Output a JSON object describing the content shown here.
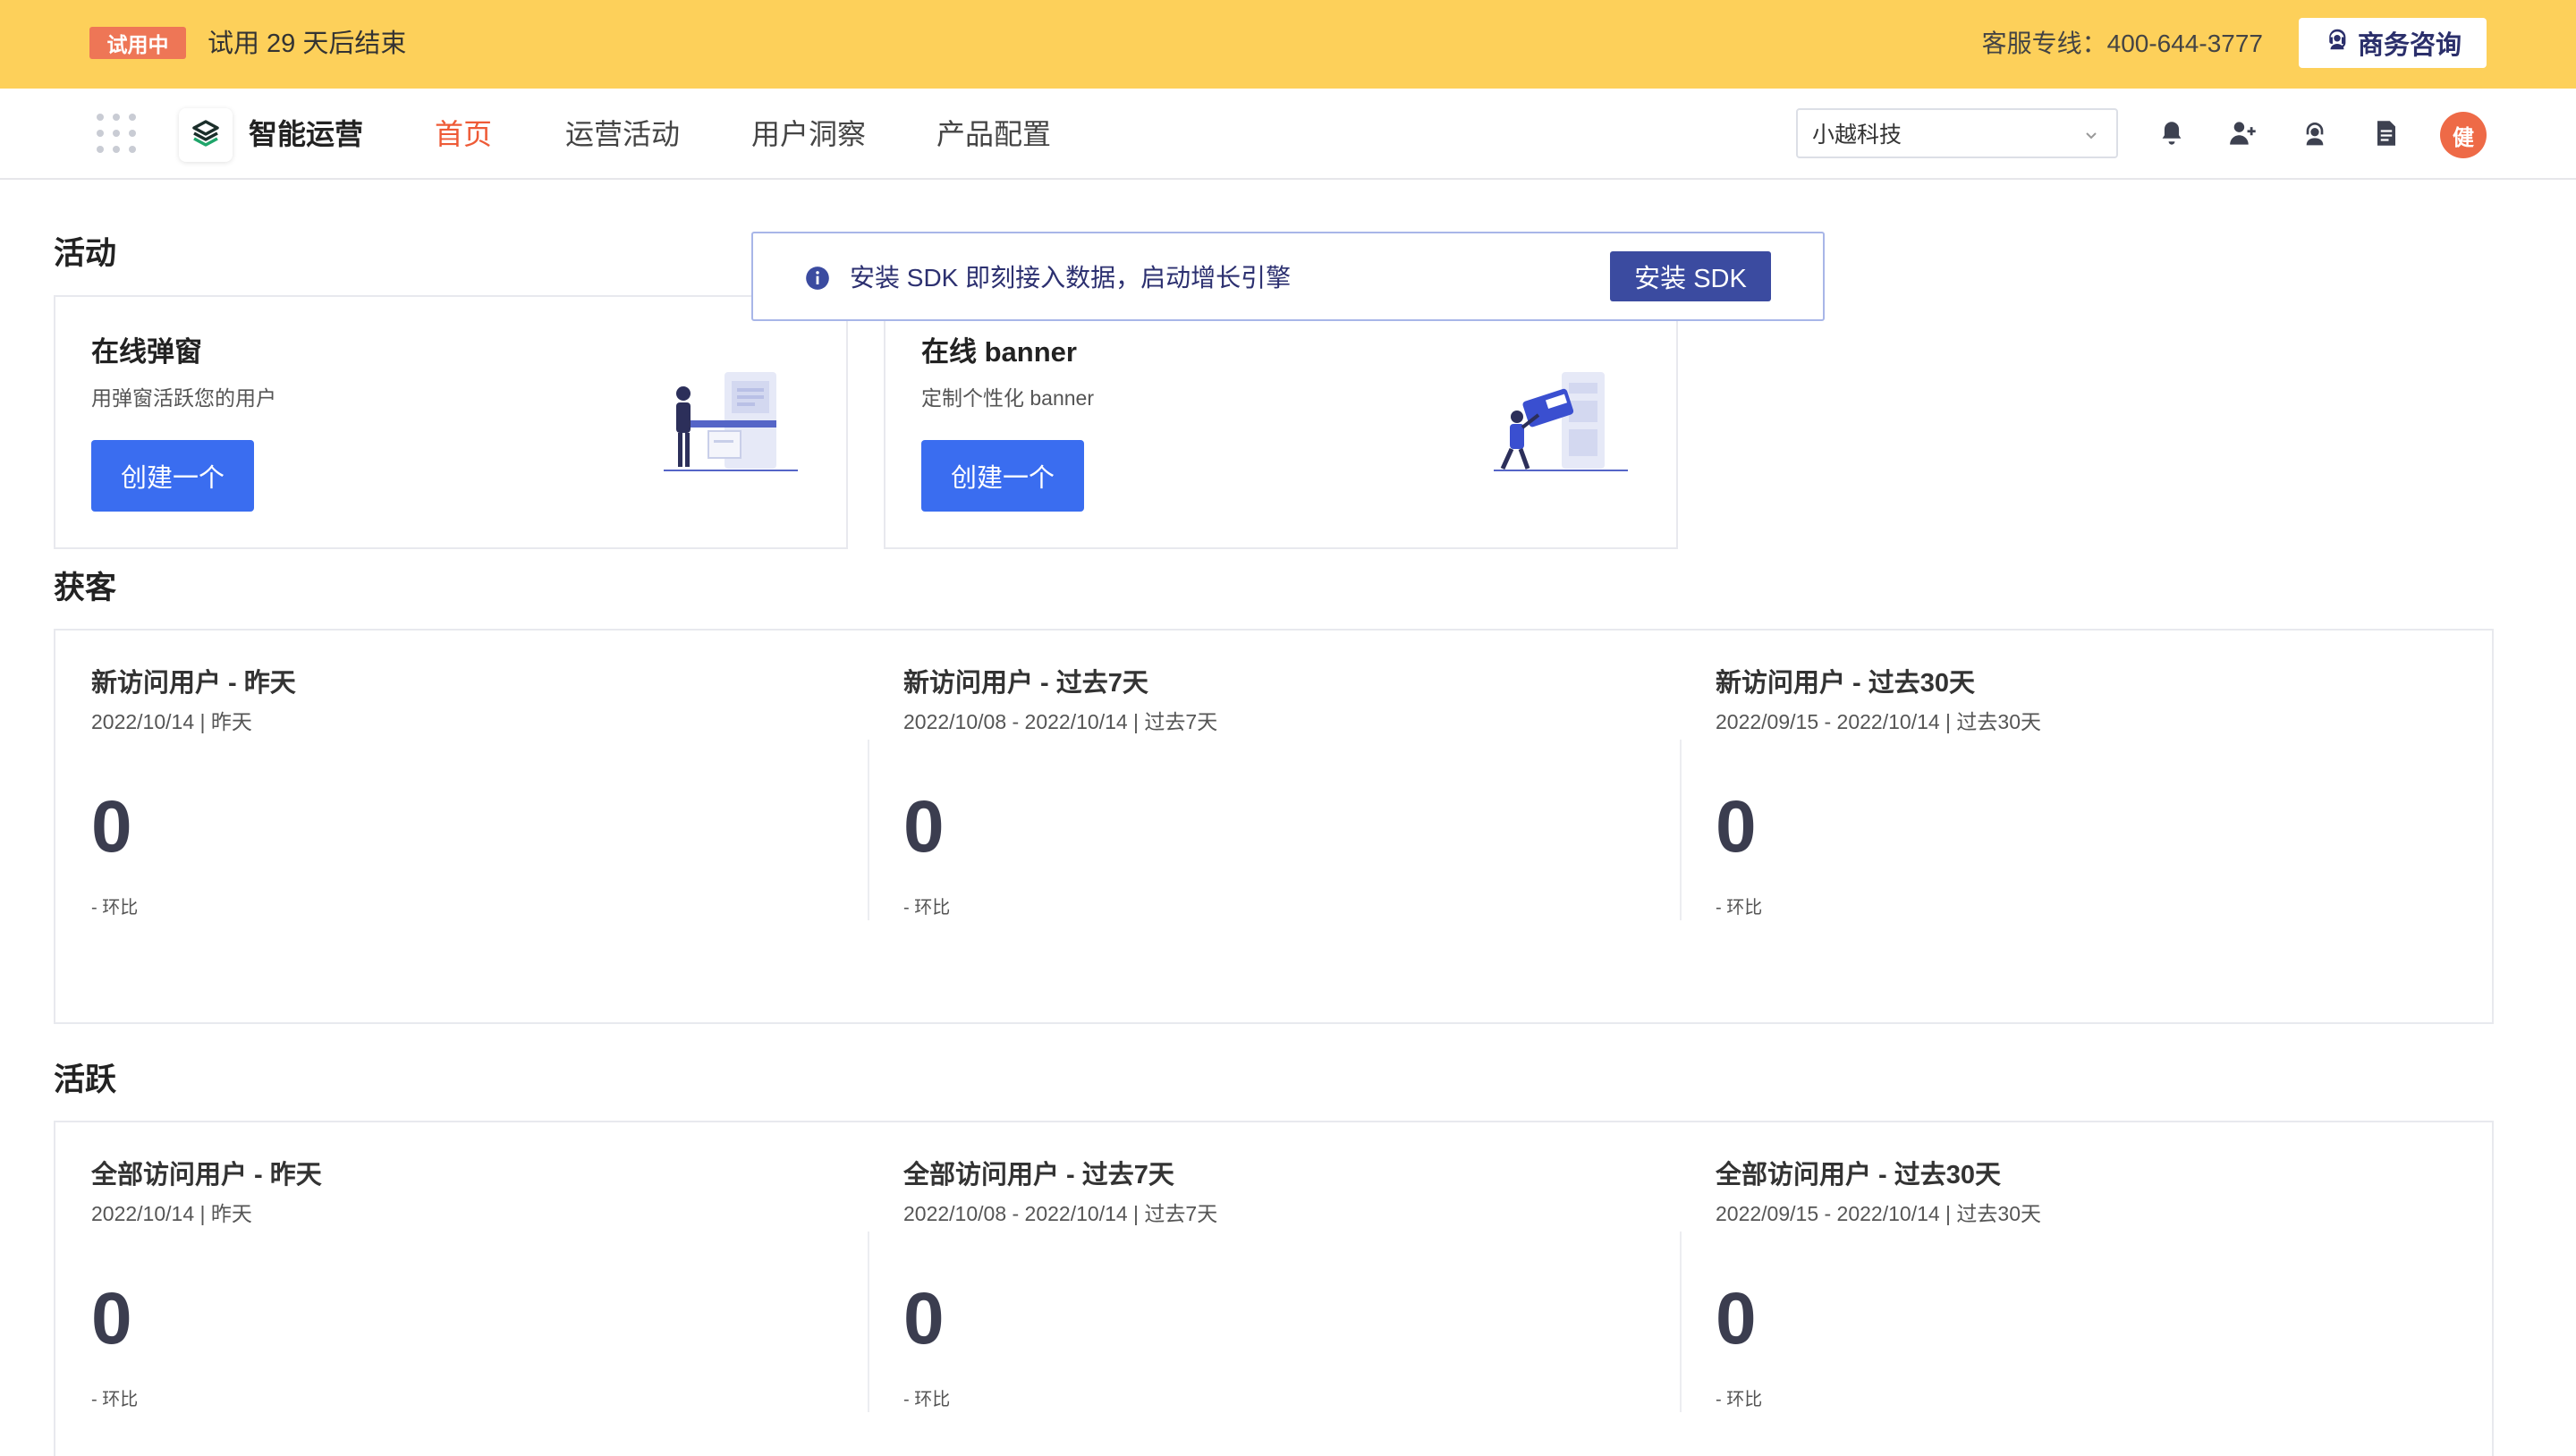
{
  "trial": {
    "badge": "试用中",
    "text": "试用 29 天后结束",
    "support": "客服专线：400-644-3777",
    "consult_button": "商务咨询"
  },
  "nav": {
    "brand": "智能运营",
    "items": [
      {
        "label": "首页",
        "active": true
      },
      {
        "label": "运营活动",
        "active": false
      },
      {
        "label": "用户洞察",
        "active": false
      },
      {
        "label": "产品配置",
        "active": false
      }
    ],
    "org_select_value": "小越科技",
    "avatar_text": "健",
    "icons": [
      "bell-icon",
      "add-user-icon",
      "support-agent-icon",
      "document-icon"
    ]
  },
  "notice": {
    "text": "安装 SDK 即刻接入数据，启动增长引擎",
    "button": "安装 SDK"
  },
  "sections": {
    "activity": {
      "title": "活动",
      "cards": [
        {
          "title": "在线弹窗",
          "desc": "用弹窗活跃您的用户",
          "button": "创建一个"
        },
        {
          "title": "在线 banner",
          "desc": "定制个性化 banner",
          "button": "创建一个"
        }
      ]
    },
    "acquisition": {
      "title": "获客",
      "metrics": [
        {
          "title": "新访问用户 - 昨天",
          "date": "2022/10/14 | 昨天",
          "value": "0",
          "change": "- 环比"
        },
        {
          "title": "新访问用户 - 过去7天",
          "date": "2022/10/08 - 2022/10/14 | 过去7天",
          "value": "0",
          "change": "- 环比"
        },
        {
          "title": "新访问用户 - 过去30天",
          "date": "2022/09/15 - 2022/10/14 | 过去30天",
          "value": "0",
          "change": "- 环比"
        }
      ]
    },
    "active": {
      "title": "活跃",
      "metrics": [
        {
          "title": "全部访问用户 - 昨天",
          "date": "2022/10/14 | 昨天",
          "value": "0",
          "change": "- 环比"
        },
        {
          "title": "全部访问用户 - 过去7天",
          "date": "2022/10/08 - 2022/10/14 | 过去7天",
          "value": "0",
          "change": "- 环比"
        },
        {
          "title": "全部访问用户 - 过去30天",
          "date": "2022/09/15 - 2022/10/14 | 过去30天",
          "value": "0",
          "change": "- 环比"
        }
      ]
    }
  },
  "colors": {
    "trial_bar": "#fdd05a",
    "accent_nav": "#ee5a36",
    "primary_button": "#3a6df0",
    "sdk_button": "#3b4ba0"
  }
}
